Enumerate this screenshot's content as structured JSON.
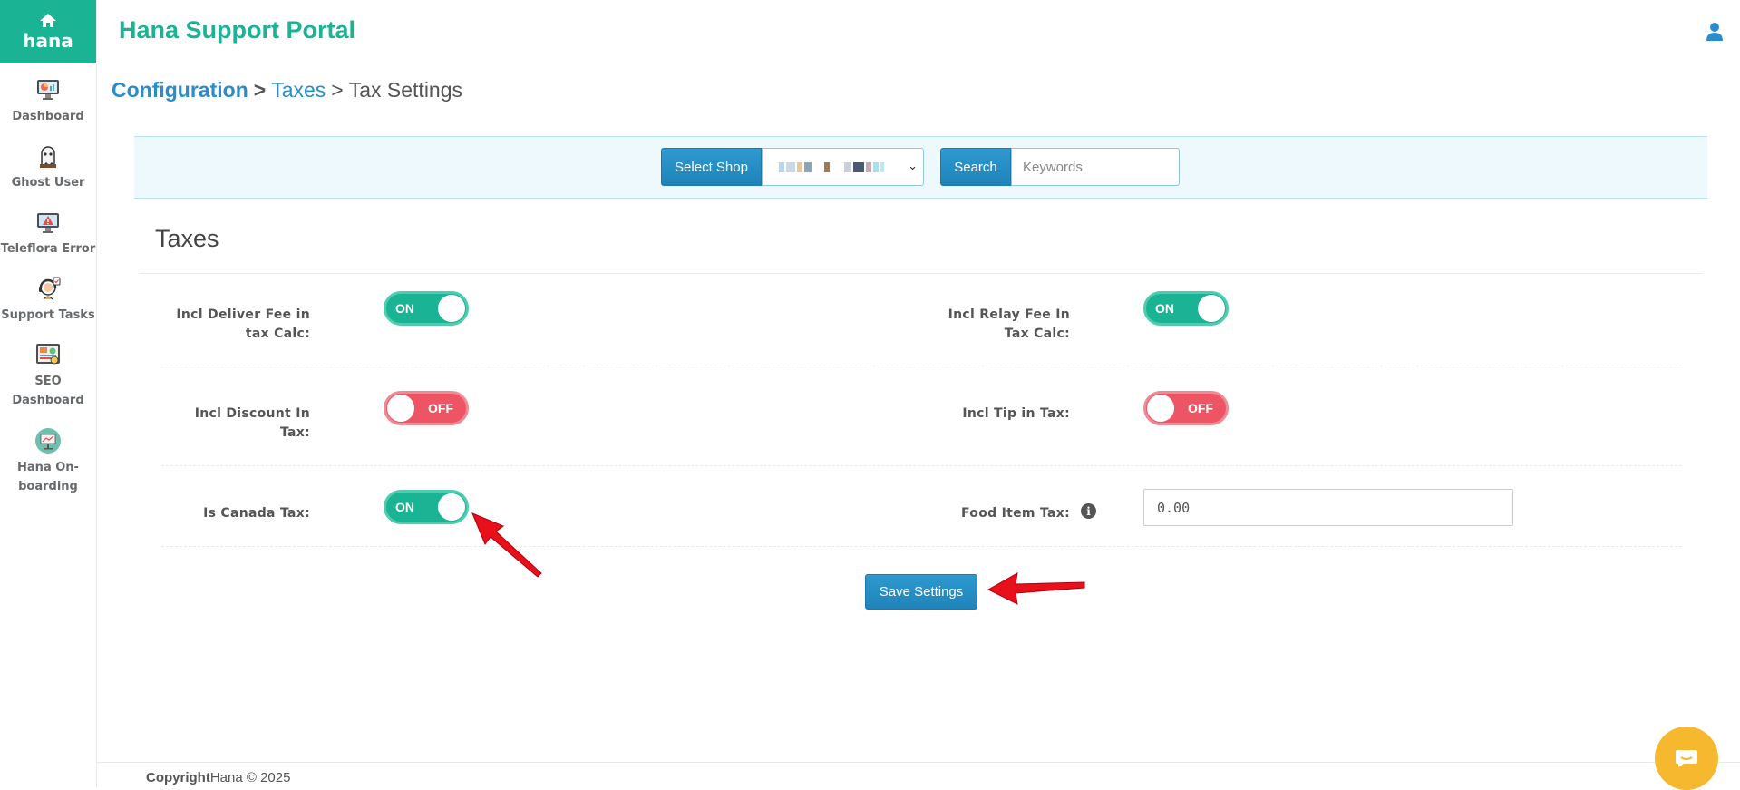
{
  "sidebar": {
    "logo": {
      "text": "hana"
    },
    "items": [
      {
        "label": "Dashboard"
      },
      {
        "label": "Ghost User"
      },
      {
        "label": "Teleflora Error"
      },
      {
        "label": "Support Tasks"
      },
      {
        "label": "SEO Dashboard"
      },
      {
        "label": "Hana On-boarding"
      }
    ]
  },
  "header": {
    "title": "Hana Support Portal"
  },
  "breadcrumb": {
    "level1": "Configuration",
    "sep": ">",
    "level2": "Taxes",
    "level3": "Tax Settings"
  },
  "toolbar": {
    "select_shop_label": "Select Shop",
    "search_label": "Search",
    "keywords_placeholder": "Keywords"
  },
  "panel": {
    "title": "Taxes",
    "fields": {
      "incl_deliver_fee": {
        "label_line1": "Incl Deliver Fee in",
        "label_line2": "tax Calc:",
        "state": "ON"
      },
      "incl_relay_fee": {
        "label_line1": "Incl Relay Fee In",
        "label_line2": "Tax Calc:",
        "state": "ON"
      },
      "incl_discount": {
        "label_line1": "Incl Discount In",
        "label_line2": "Tax:",
        "state": "OFF"
      },
      "incl_tip": {
        "label": "Incl Tip in Tax:",
        "state": "OFF"
      },
      "is_canada_tax": {
        "label": "Is Canada Tax:",
        "state": "ON"
      },
      "food_item_tax": {
        "label": "Food Item Tax:",
        "value": "0.00"
      }
    },
    "save_label": "Save Settings"
  },
  "footer": {
    "copyright_bold": "Copyright",
    "copyright_rest": "Hana © 2025"
  },
  "colors": {
    "primary_green": "#1ab394",
    "off_red": "#ed5565",
    "blue_button": "#2a8dcb",
    "chat_yellow": "#f5b82e"
  }
}
